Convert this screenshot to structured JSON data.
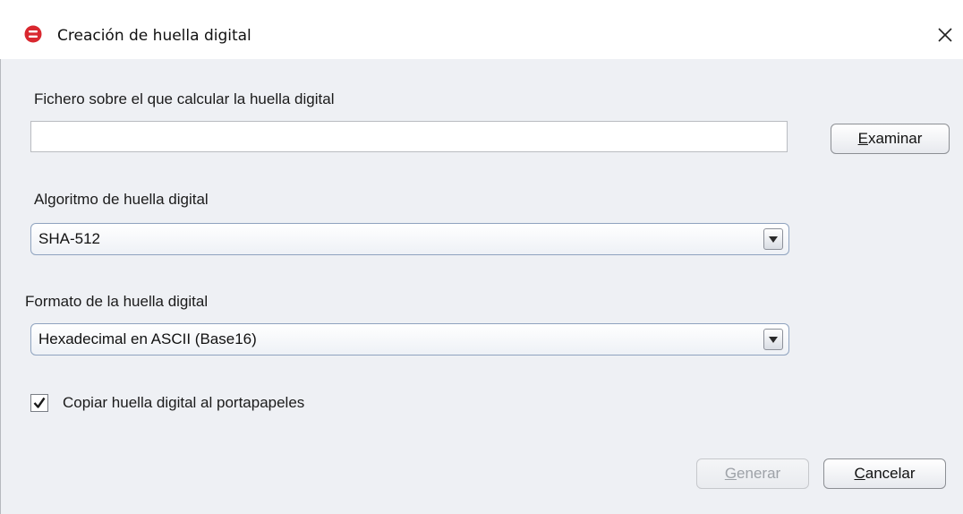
{
  "window": {
    "title": "Creación de huella digital",
    "close_symbol": "✕",
    "app_icon": "app-logo-icon"
  },
  "file_section": {
    "label": "Fichero sobre el que calcular la huella digital",
    "input_value": "",
    "browse_button": {
      "mnemonic": "E",
      "rest": "xaminar"
    }
  },
  "algorithm_section": {
    "label": "Algoritmo de huella digital",
    "selected": "SHA-512"
  },
  "format_section": {
    "label": "Formato de la huella digital",
    "selected": "Hexadecimal en ASCII (Base16)"
  },
  "copy_option": {
    "label": "Copiar huella digital al portapapeles",
    "checked": true
  },
  "buttons": {
    "generate": {
      "mnemonic": "G",
      "rest": "enerar",
      "enabled": false
    },
    "cancel": {
      "mnemonic": "C",
      "rest": "ancelar"
    }
  },
  "colors": {
    "app_icon": "#d9282f",
    "background": "#eef0f4"
  }
}
